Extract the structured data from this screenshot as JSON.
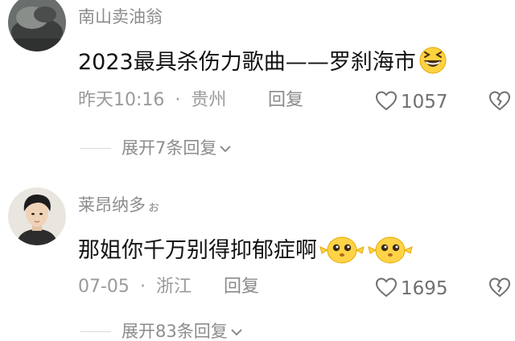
{
  "comments": [
    {
      "username": "南山卖油翁",
      "content": "2023最具杀伤力歌曲——罗刹海市",
      "time": "昨天10:16",
      "location": "贵州",
      "reply_label": "回复",
      "likes": "1057",
      "expand_label": "展开7条回复",
      "emoji": [
        "grinning-squint-face"
      ]
    },
    {
      "username": "莱昂纳多",
      "username_suffix": "ぉ",
      "content": "那姐你千万别得抑郁症啊",
      "time": "07-05",
      "location": "浙江",
      "reply_label": "回复",
      "likes": "1695",
      "expand_label": "展开83条回复",
      "emoji": [
        "pleading-chick",
        "pleading-chick"
      ]
    }
  ],
  "separator": "·",
  "icons": {
    "like": "heart-outline-icon",
    "dislike": "broken-heart-icon",
    "expand": "chevron-down-icon"
  },
  "colors": {
    "username": "#8c8c8c",
    "content": "#121212",
    "meta": "#9a9a9a"
  }
}
